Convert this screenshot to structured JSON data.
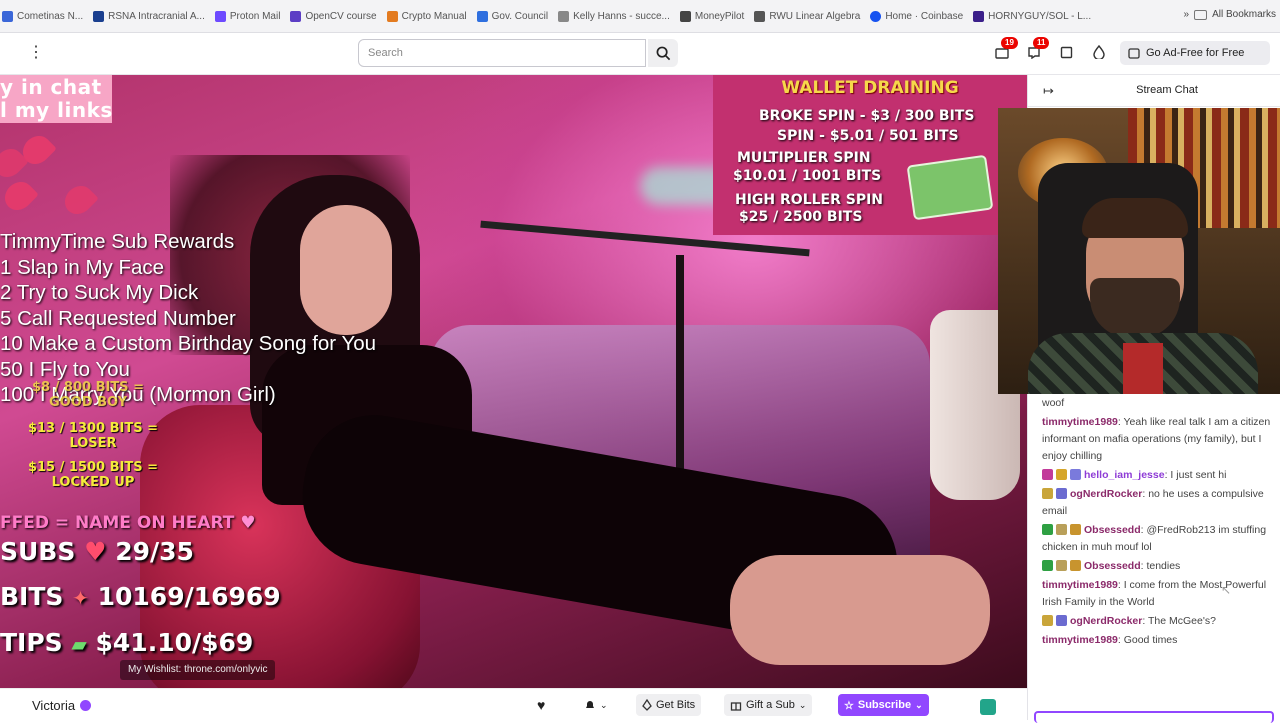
{
  "bookmarks": [
    {
      "label": "Cometinas N..."
    },
    {
      "label": "RSNA Intracranial A..."
    },
    {
      "label": "Proton Mail"
    },
    {
      "label": "OpenCV course"
    },
    {
      "label": "Crypto Manual"
    },
    {
      "label": "Gov. Council"
    },
    {
      "label": "Kelly Hanns - succe..."
    },
    {
      "label": "MoneyPilot"
    },
    {
      "label": "RWU Linear Algebra"
    },
    {
      "label": "Home · Coinbase"
    },
    {
      "label": "HORNYGUY/SOL - L..."
    }
  ],
  "bookmarks_right": {
    "overflow": "»",
    "all_bookmarks": "All Bookmarks"
  },
  "topbar": {
    "search_placeholder": "Search",
    "notifications_count": "19",
    "inbox_count": "11",
    "ad_free_label": "Go Ad-Free for Free"
  },
  "overlay": {
    "top_left_line1": "y in chat",
    "top_left_line2": "l my links",
    "rewards": [
      "TimmyTime Sub Rewards",
      "1 Slap in My Face",
      "2 Try to Suck My Dick",
      "5 Call Requested Number",
      "10 Make a Custom Birthday Song for You",
      "50 I Fly to You",
      "100 I Marry You (Mormon Girl)"
    ],
    "bits_tiers": [
      {
        "line1": "$8 / 800 BITS =",
        "line2": "GOOD BOY"
      },
      {
        "line1": "$13 / 1300 BITS =",
        "line2": "LOSER"
      },
      {
        "line1": "$15 / 1500 BITS =",
        "line2": "LOCKED UP"
      }
    ],
    "pink_line": "FFED = NAME ON HEART",
    "subs": {
      "label": "SUBS",
      "value": "29/35"
    },
    "bits": {
      "label": "BITS",
      "value": "10169/16969"
    },
    "tips": {
      "label": "TIPS",
      "value": "$41.10/$69"
    },
    "wishlist": "My Wishlist: throne.com/onlyvic",
    "wallet": {
      "title": "WALLET DRAINING",
      "lines": [
        "BROKE SPIN - $3 / 300 BITS",
        "SPIN - $5.01 / 501 BITS",
        "MULTIPLIER SPIN",
        "$10.01 / 1001 BITS",
        "HIGH ROLLER SPIN",
        "$25 / 2500 BITS"
      ]
    }
  },
  "chat": {
    "title": "Stream Chat",
    "messages": [
      {
        "user": "",
        "text": "woof"
      },
      {
        "user": "timmytime1989",
        "text": ": Yeah like real talk I am a citizen informant on mafia operations (my family), but I enjoy chilling"
      },
      {
        "user": "hello_iam_jesse",
        "text": ": I just sent hi"
      },
      {
        "user": "ogNerdRocker",
        "text": ": no he uses a compulsive email"
      },
      {
        "user": "Obsessedd",
        "text": ": @FredRob213 im stuffing chicken in muh mouf lol"
      },
      {
        "user": "Obsessedd",
        "text": ": tendies"
      },
      {
        "user": "timmytime1989",
        "text": ": I come from the Most Powerful Irish Family in the World"
      },
      {
        "user": "ogNerdRocker",
        "text": ": The McGee's?"
      },
      {
        "user": "timmytime1989",
        "text": ": Good times"
      }
    ]
  },
  "bottom": {
    "channel_name": "Victoria",
    "get_bits": "Get Bits",
    "gift_sub": "Gift a Sub",
    "subscribe": "Subscribe"
  },
  "colors": {
    "accent": "#9147ff",
    "badge": "#eb0400",
    "username": "#8b2a6a"
  }
}
